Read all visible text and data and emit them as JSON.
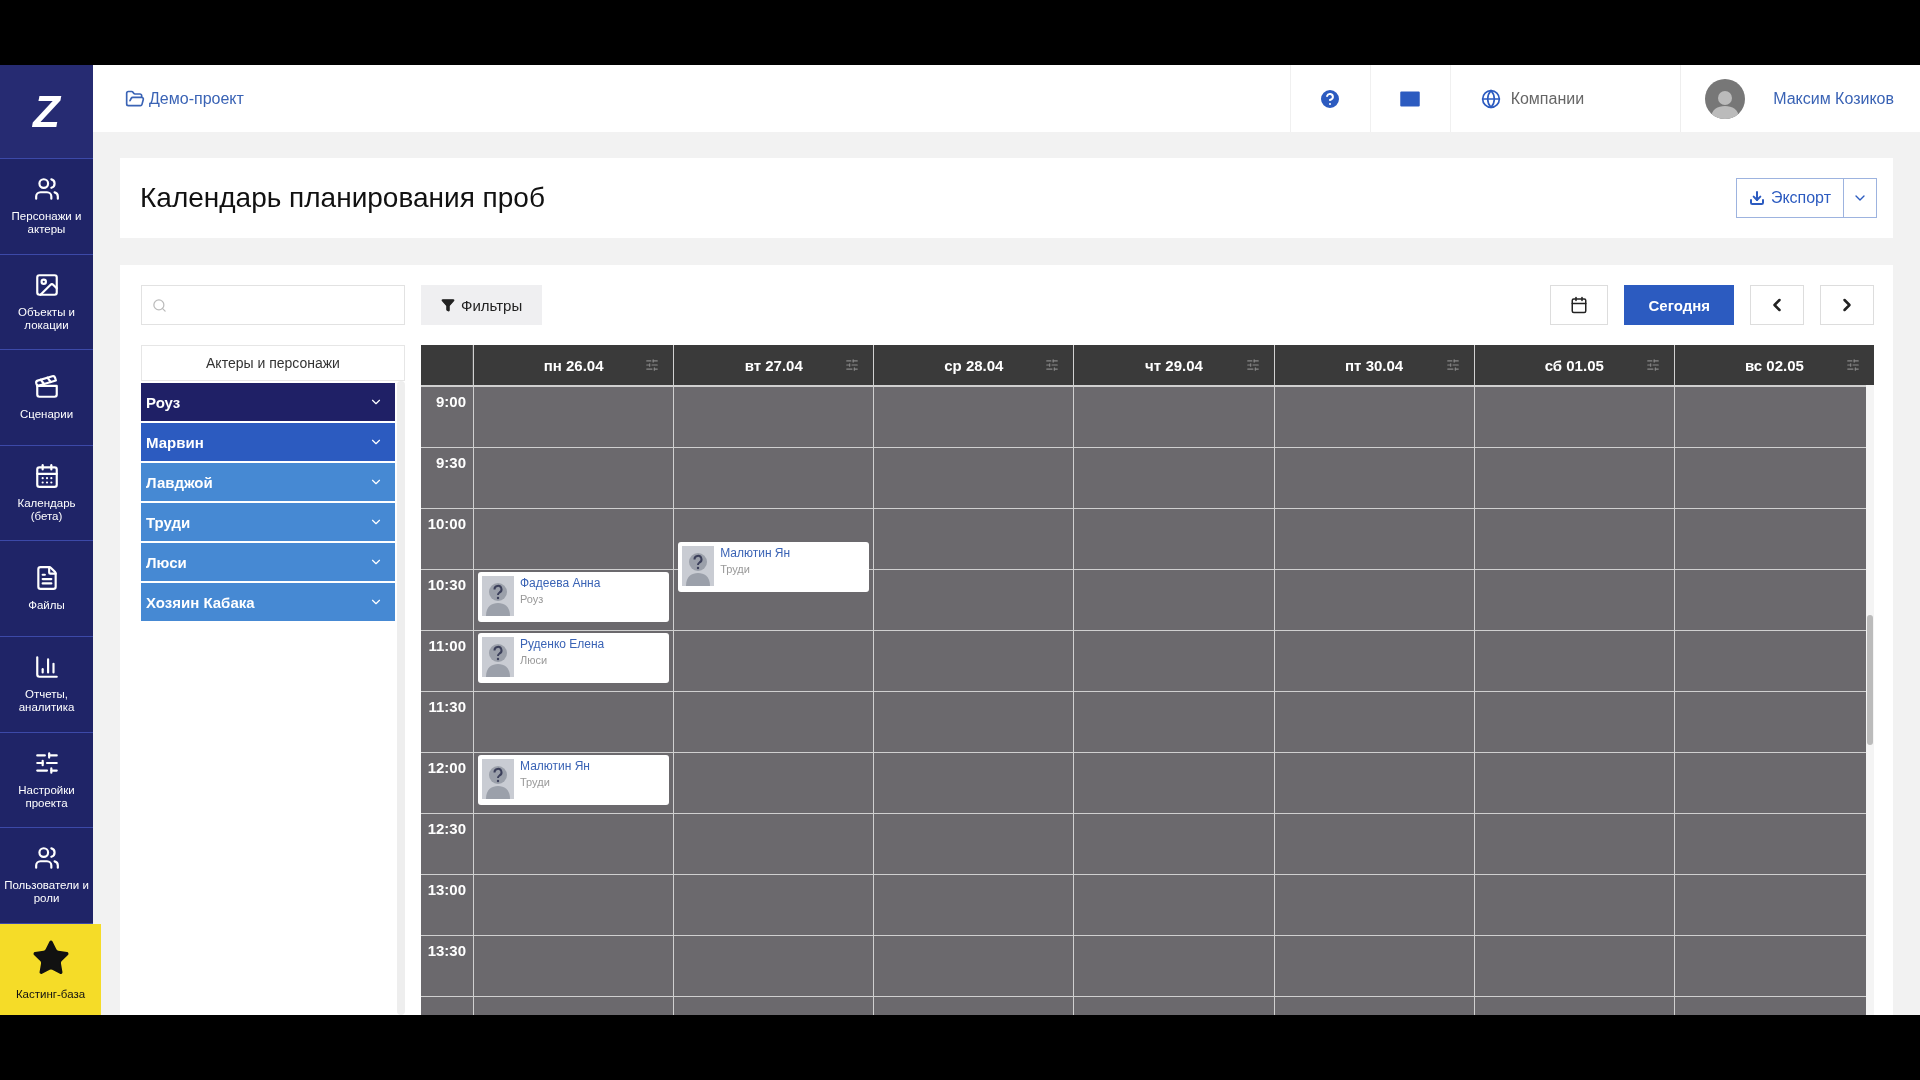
{
  "sidebar": {
    "logo": "Z",
    "items": [
      {
        "label": "Персонажи и актеры"
      },
      {
        "label": "Объекты и локации"
      },
      {
        "label": "Сценарии"
      },
      {
        "label": "Календарь (бета)"
      },
      {
        "label": "Файлы"
      },
      {
        "label": "Отчеты, аналитика"
      },
      {
        "label": "Настройки проекта"
      },
      {
        "label": "Пользователи и роли"
      }
    ],
    "featured": {
      "label": "Кастинг-база"
    }
  },
  "header": {
    "project": "Демо-проект",
    "companies": "Компании",
    "user": "Максим Козиков"
  },
  "page": {
    "title": "Календарь планирования проб",
    "export": "Экспорт"
  },
  "toolbar": {
    "filters": "Фильтры",
    "today": "Сегодня"
  },
  "roles": {
    "heading": "Актеры и персонажи",
    "items": [
      {
        "name": "Роуз",
        "color": "#1f2066"
      },
      {
        "name": "Марвин",
        "color": "#2c5bc0"
      },
      {
        "name": "Лавджой",
        "color": "#4689d3"
      },
      {
        "name": "Труди",
        "color": "#4689d3"
      },
      {
        "name": "Люси",
        "color": "#4689d3"
      },
      {
        "name": "Хозяин Кабака",
        "color": "#4689d3"
      }
    ]
  },
  "calendar": {
    "rows": [
      {
        "time": "9:00"
      },
      {
        "time": "9:30"
      },
      {
        "time": "10:00",
        "events_quarter_past": [
          {
            "kind": "tuesday",
            "name": "Малютин Ян",
            "role": "Труди"
          }
        ]
      },
      {
        "time": "10:30",
        "events": [
          {
            "kind": "monday",
            "name": "Фадеева Анна",
            "role": "Роуз"
          }
        ]
      },
      {
        "time": "11:00",
        "events": [
          {
            "kind": "monday",
            "name": "Руденко Елена",
            "role": "Люси"
          }
        ]
      },
      {
        "time": "11:30"
      },
      {
        "time": "12:00",
        "events": [
          {
            "kind": "monday",
            "name": "Малютин Ян",
            "role": "Труди"
          }
        ]
      },
      {
        "time": "12:30"
      },
      {
        "time": "13:00"
      },
      {
        "time": "13:30"
      }
    ],
    "days": [
      {
        "label": "пн 26.04"
      },
      {
        "label": "вт 27.04"
      },
      {
        "label": "ср 28.04"
      },
      {
        "label": "чт 29.04"
      },
      {
        "label": "пт 30.04"
      },
      {
        "label": "сб 01.05"
      },
      {
        "label": "вс 02.05"
      }
    ]
  }
}
